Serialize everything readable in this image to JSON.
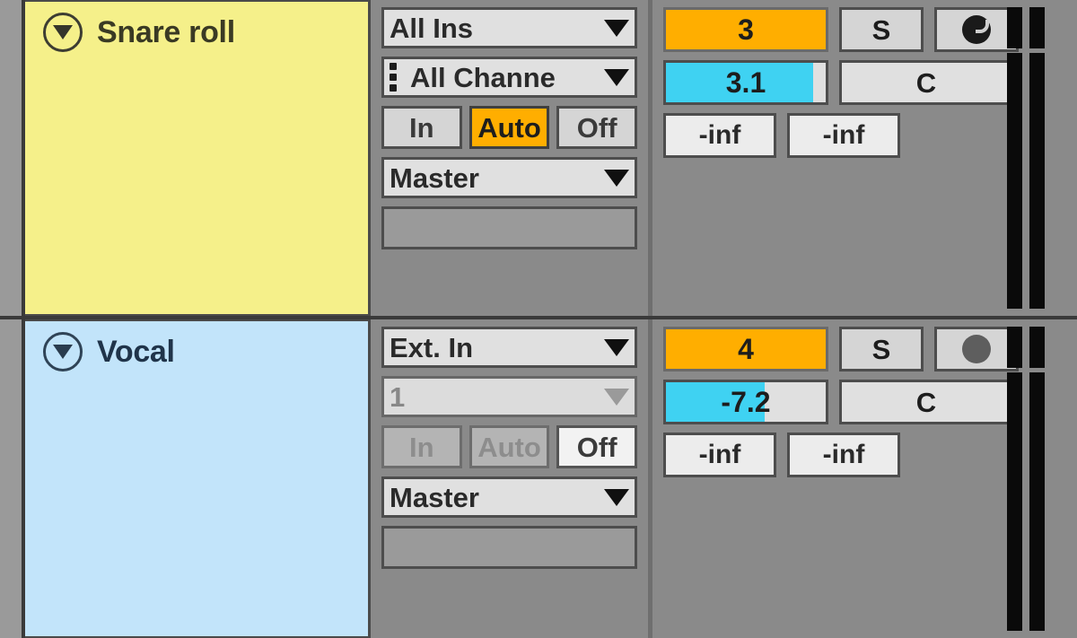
{
  "app": {
    "name": "ableton-live-track-headers"
  },
  "colors": {
    "background": "#8a8a8a",
    "track1_color": "#f5f08a",
    "track2_color": "#c2e4fa",
    "accent_orange": "#ffae00",
    "accent_cyan": "#3fd2f2",
    "panel_light": "#e0e0e0",
    "border_dark": "#4d4d4d"
  },
  "tracks": [
    {
      "name": "Snare roll",
      "color": "#f5f08a",
      "title_color": "#3a3a24",
      "type": "midi",
      "fold_icon": "chevron-down-circle-icon",
      "routing": {
        "input_type": "All Ins",
        "input_channel": "All Channe",
        "input_channel_enabled": true,
        "input_channel_icon": "midi-dots-icon",
        "monitor": {
          "in": "In",
          "auto": "Auto",
          "off": "Off",
          "selected": "Auto",
          "enabled": true
        },
        "output_type": "Master",
        "output_channel": ""
      },
      "mixer": {
        "track_number": "3",
        "solo_label": "S",
        "arm_icon": "midi-arm-icon",
        "volume": "3.1",
        "volume_fill_pct": 92,
        "pan_label": "C",
        "send_a": "-inf",
        "send_b": "-inf"
      }
    },
    {
      "name": "Vocal",
      "color": "#c2e4fa",
      "title_color": "#20344a",
      "type": "audio",
      "fold_icon": "chevron-down-circle-icon",
      "routing": {
        "input_type": "Ext. In",
        "input_channel": "1",
        "input_channel_enabled": false,
        "input_channel_icon": "",
        "monitor": {
          "in": "In",
          "auto": "Auto",
          "off": "Off",
          "selected": "Off",
          "enabled": false
        },
        "output_type": "Master",
        "output_channel": ""
      },
      "mixer": {
        "track_number": "4",
        "solo_label": "S",
        "arm_icon": "record-arm-icon",
        "volume": "-7.2",
        "volume_fill_pct": 62,
        "pan_label": "C",
        "send_a": "-inf",
        "send_b": "-inf"
      }
    }
  ]
}
